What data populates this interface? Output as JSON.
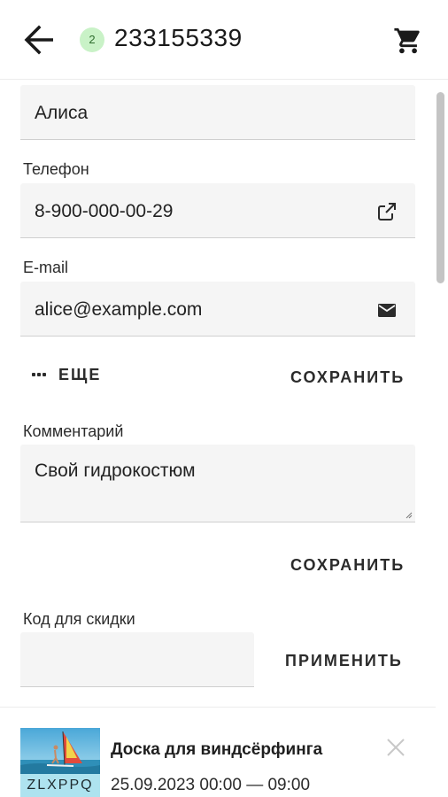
{
  "header": {
    "badge": "2",
    "order_number": "233155339",
    "back_icon": "arrow-left-icon",
    "cart_icon": "cart-icon"
  },
  "form": {
    "name_value": "Алиса",
    "phone_label": "Телефон",
    "phone_value": "8-900-000-00-29",
    "phone_icon": "external-link-icon",
    "email_label": "E-mail",
    "email_value": "alice@example.com",
    "email_icon": "envelope-icon",
    "more_label": "ЕЩЕ",
    "save_label": "СОХРАНИТЬ",
    "comment_label": "Комментарий",
    "comment_value": "Свой гидрокостюм",
    "comment_save_label": "СОХРАНИТЬ",
    "discount_label": "Код для скидки",
    "discount_value": "",
    "apply_label": "ПРИМЕНИТЬ"
  },
  "booking": {
    "title": "Доска для виндсёрфинга",
    "date": "25.09.2023 00:00 — 09:00",
    "code": "ZLXPPQ",
    "close_icon": "close-icon"
  },
  "colors": {
    "badge_bg": "#c9f2c7",
    "field_bg": "#f5f5f5",
    "code_bg": "#aee3ef"
  }
}
